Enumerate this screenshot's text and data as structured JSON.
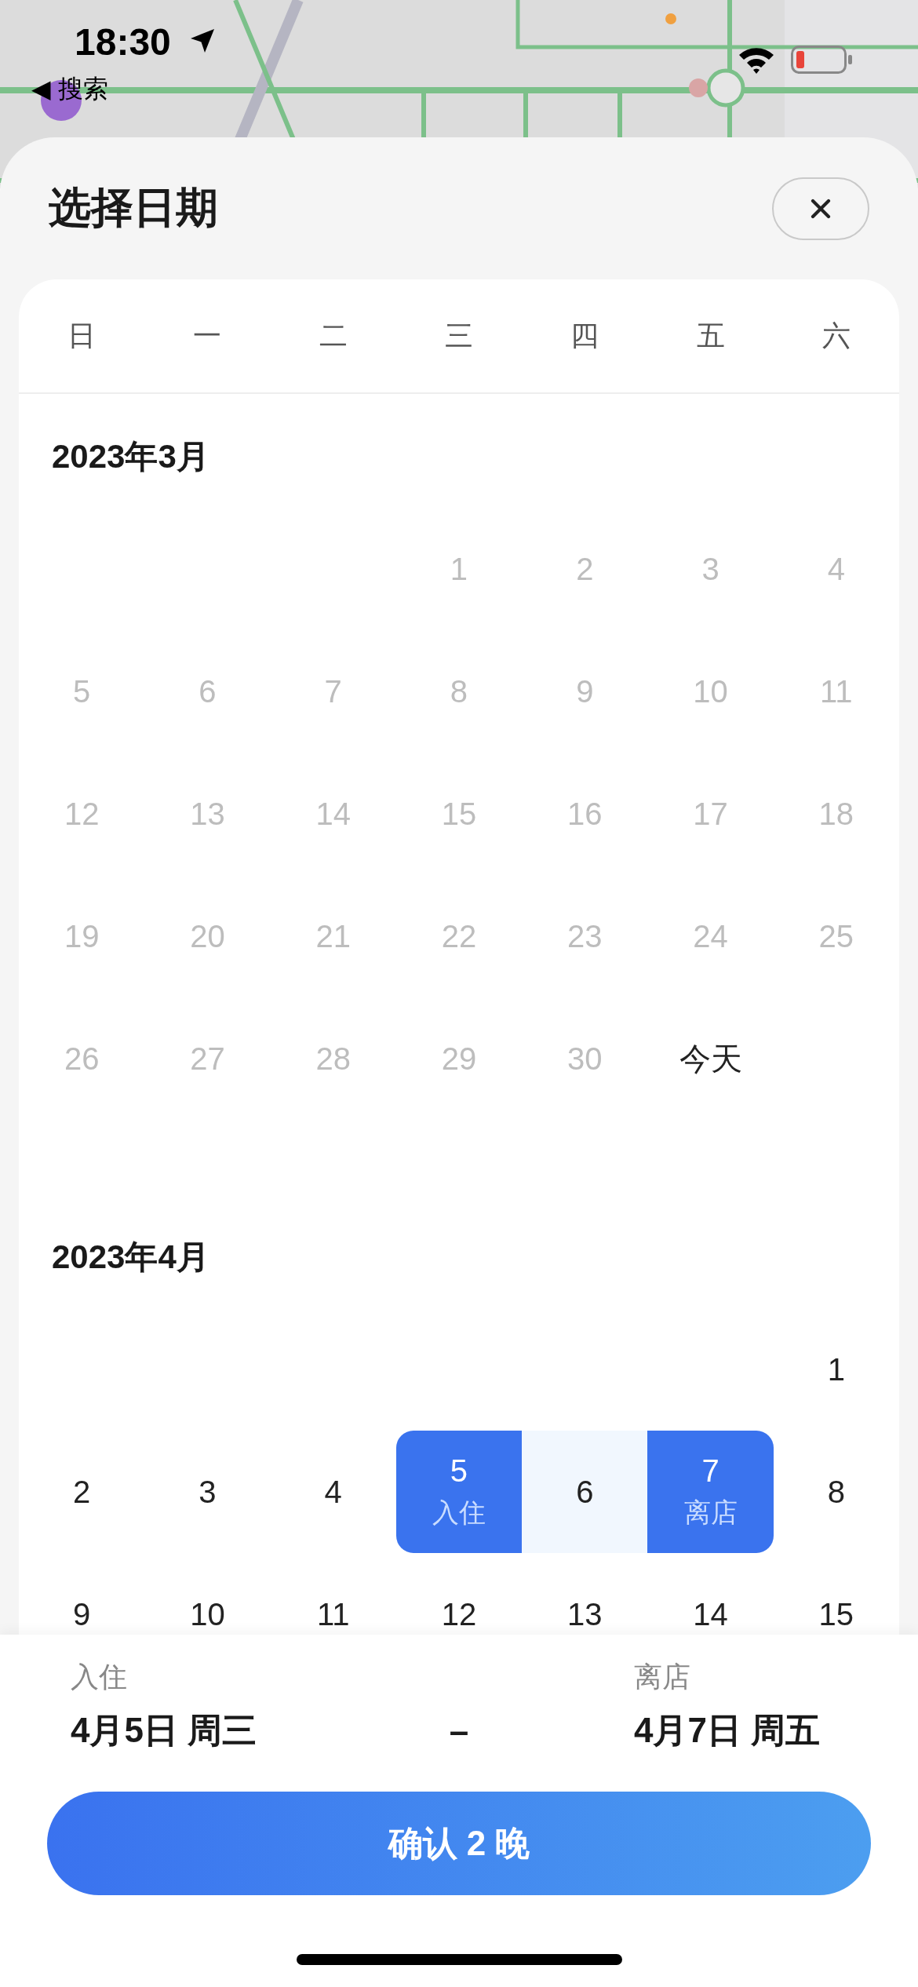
{
  "status_bar": {
    "time": "18:30",
    "back_link": "◀ 搜索"
  },
  "sheet": {
    "title": "选择日期"
  },
  "weekdays": [
    "日",
    "一",
    "二",
    "三",
    "四",
    "五",
    "六"
  ],
  "months": [
    {
      "title": "2023年3月",
      "weeks": [
        [
          {
            "kind": "blank"
          },
          {
            "kind": "blank"
          },
          {
            "kind": "blank"
          },
          {
            "kind": "past",
            "label": "1",
            "selected": false
          },
          {
            "kind": "past",
            "label": "2",
            "selected": false
          },
          {
            "kind": "past",
            "label": "3",
            "selected": false
          },
          {
            "kind": "past",
            "label": "4",
            "selected": false
          }
        ],
        [
          {
            "kind": "past",
            "label": "5",
            "selected": false
          },
          {
            "kind": "past",
            "label": "6",
            "selected": false
          },
          {
            "kind": "past",
            "label": "7",
            "selected": false
          },
          {
            "kind": "past",
            "label": "8",
            "selected": false
          },
          {
            "kind": "past",
            "label": "9",
            "selected": false
          },
          {
            "kind": "past",
            "label": "10",
            "selected": false
          },
          {
            "kind": "past",
            "label": "11",
            "selected": false
          }
        ],
        [
          {
            "kind": "past",
            "label": "12",
            "selected": false
          },
          {
            "kind": "past",
            "label": "13",
            "selected": false
          },
          {
            "kind": "past",
            "label": "14",
            "selected": false
          },
          {
            "kind": "past",
            "label": "15",
            "selected": false
          },
          {
            "kind": "past",
            "label": "16",
            "selected": false
          },
          {
            "kind": "past",
            "label": "17",
            "selected": false
          },
          {
            "kind": "past",
            "label": "18",
            "selected": false
          }
        ],
        [
          {
            "kind": "past",
            "label": "19",
            "selected": false
          },
          {
            "kind": "past",
            "label": "20",
            "selected": false
          },
          {
            "kind": "past",
            "label": "21",
            "selected": false
          },
          {
            "kind": "past",
            "label": "22",
            "selected": false
          },
          {
            "kind": "past",
            "label": "23",
            "selected": false
          },
          {
            "kind": "past",
            "label": "24",
            "selected": false
          },
          {
            "kind": "past",
            "label": "25",
            "selected": false
          }
        ],
        [
          {
            "kind": "past",
            "label": "26",
            "selected": false
          },
          {
            "kind": "past",
            "label": "27",
            "selected": false
          },
          {
            "kind": "past",
            "label": "28",
            "selected": false
          },
          {
            "kind": "past",
            "label": "29",
            "selected": false
          },
          {
            "kind": "past",
            "label": "30",
            "selected": false
          },
          {
            "kind": "today",
            "label": "今天",
            "selected": false
          },
          {
            "kind": "blank"
          }
        ]
      ]
    },
    {
      "title": "2023年4月",
      "weeks": [
        [
          {
            "kind": "blank"
          },
          {
            "kind": "blank"
          },
          {
            "kind": "blank"
          },
          {
            "kind": "blank"
          },
          {
            "kind": "blank"
          },
          {
            "kind": "blank"
          },
          {
            "kind": "normal",
            "label": "1",
            "selected": false
          }
        ],
        [
          {
            "kind": "normal",
            "label": "2",
            "selected": false
          },
          {
            "kind": "normal",
            "label": "3",
            "selected": false
          },
          {
            "kind": "normal",
            "label": "4",
            "selected": false
          },
          {
            "kind": "start",
            "label": "5",
            "note": "入住",
            "selected": true
          },
          {
            "kind": "range",
            "label": "6",
            "selected": false
          },
          {
            "kind": "end",
            "label": "7",
            "note": "离店",
            "selected": true
          },
          {
            "kind": "normal",
            "label": "8",
            "selected": false
          }
        ],
        [
          {
            "kind": "normal",
            "label": "9",
            "selected": false
          },
          {
            "kind": "normal",
            "label": "10",
            "selected": false
          },
          {
            "kind": "normal",
            "label": "11",
            "selected": false
          },
          {
            "kind": "normal",
            "label": "12",
            "selected": false
          },
          {
            "kind": "normal",
            "label": "13",
            "selected": false
          },
          {
            "kind": "normal",
            "label": "14",
            "selected": false
          },
          {
            "kind": "normal",
            "label": "15",
            "selected": false
          }
        ]
      ]
    }
  ],
  "summary": {
    "check_in": {
      "label": "入住",
      "date": "4月5日 周三"
    },
    "separator": "–",
    "check_out": {
      "label": "离店",
      "date": "4月7日 周五"
    }
  },
  "confirm_button": "确认 2 晚"
}
